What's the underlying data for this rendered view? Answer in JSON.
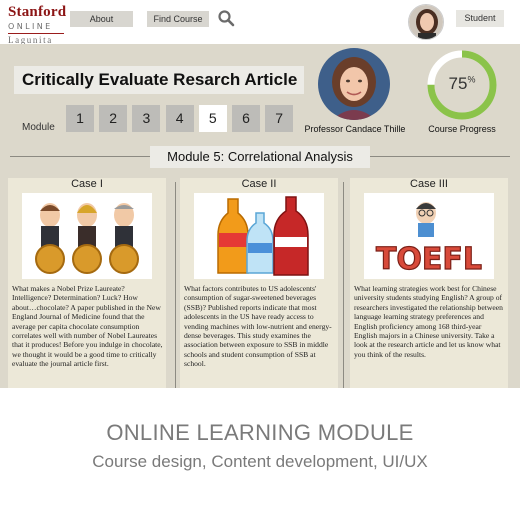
{
  "logo": {
    "line1": "Stanford",
    "line2": "ONLINE",
    "line3": "Lagunita"
  },
  "nav": {
    "about": "About",
    "find_course": "Find Course",
    "search_icon": "search-icon"
  },
  "user": {
    "label": "Student"
  },
  "page_title": "Critically Evaluate Resarch Article",
  "module_label": "Module",
  "modules": [
    {
      "label": "1",
      "active": false
    },
    {
      "label": "2",
      "active": false
    },
    {
      "label": "3",
      "active": false
    },
    {
      "label": "4",
      "active": false
    },
    {
      "label": "5",
      "active": true
    },
    {
      "label": "6",
      "active": false
    },
    {
      "label": "7",
      "active": false
    }
  ],
  "professor": {
    "name": "Professor Candace Thille"
  },
  "progress": {
    "value": 0.75,
    "display": "75",
    "unit": "%",
    "label": "Course Progress",
    "color": "#8bc34a"
  },
  "section_heading": "Module 5: Correlational Analysis",
  "cases": [
    {
      "title": "Case I",
      "image": "nobel-laureates-chocolate-illustration",
      "text": "What makes a Nobel Prize Laureate? Intelligence? Determination? Luck? How about…chocolate? A paper published in the New England Journal of Medicine found that the average per capita chocolate consumption correlates well with number of Nobel Laureates that it produces! Before you indulge in chocolate, we thought it would be a good time to critically evaluate the journal article first."
    },
    {
      "title": "Case II",
      "image": "soda-bottles-illustration",
      "text": "What factors contributes to US adolescents' consumption of sugar-sweetened beverages (SSB)? Published reports indicate that most adolescents in the US have ready access to vending machines with low-nutrient and energy-dense beverages. This study examines the association between exposure to SSB in middle schools and student consumption of SSB at school."
    },
    {
      "title": "Case III",
      "image": "toefl-student-illustration",
      "text": "What learning strategies work best for Chinese university students studying English? A group of researchers investigated the relationship between language learning strategy preferences and English proficiency among 168 third-year English majors in a Chinese university. Take a look at the research article and let us know what you think of the results."
    }
  ],
  "caption": {
    "line1": "ONLINE LEARNING MODULE",
    "line2": "Course design, Content development, UI/UX"
  }
}
